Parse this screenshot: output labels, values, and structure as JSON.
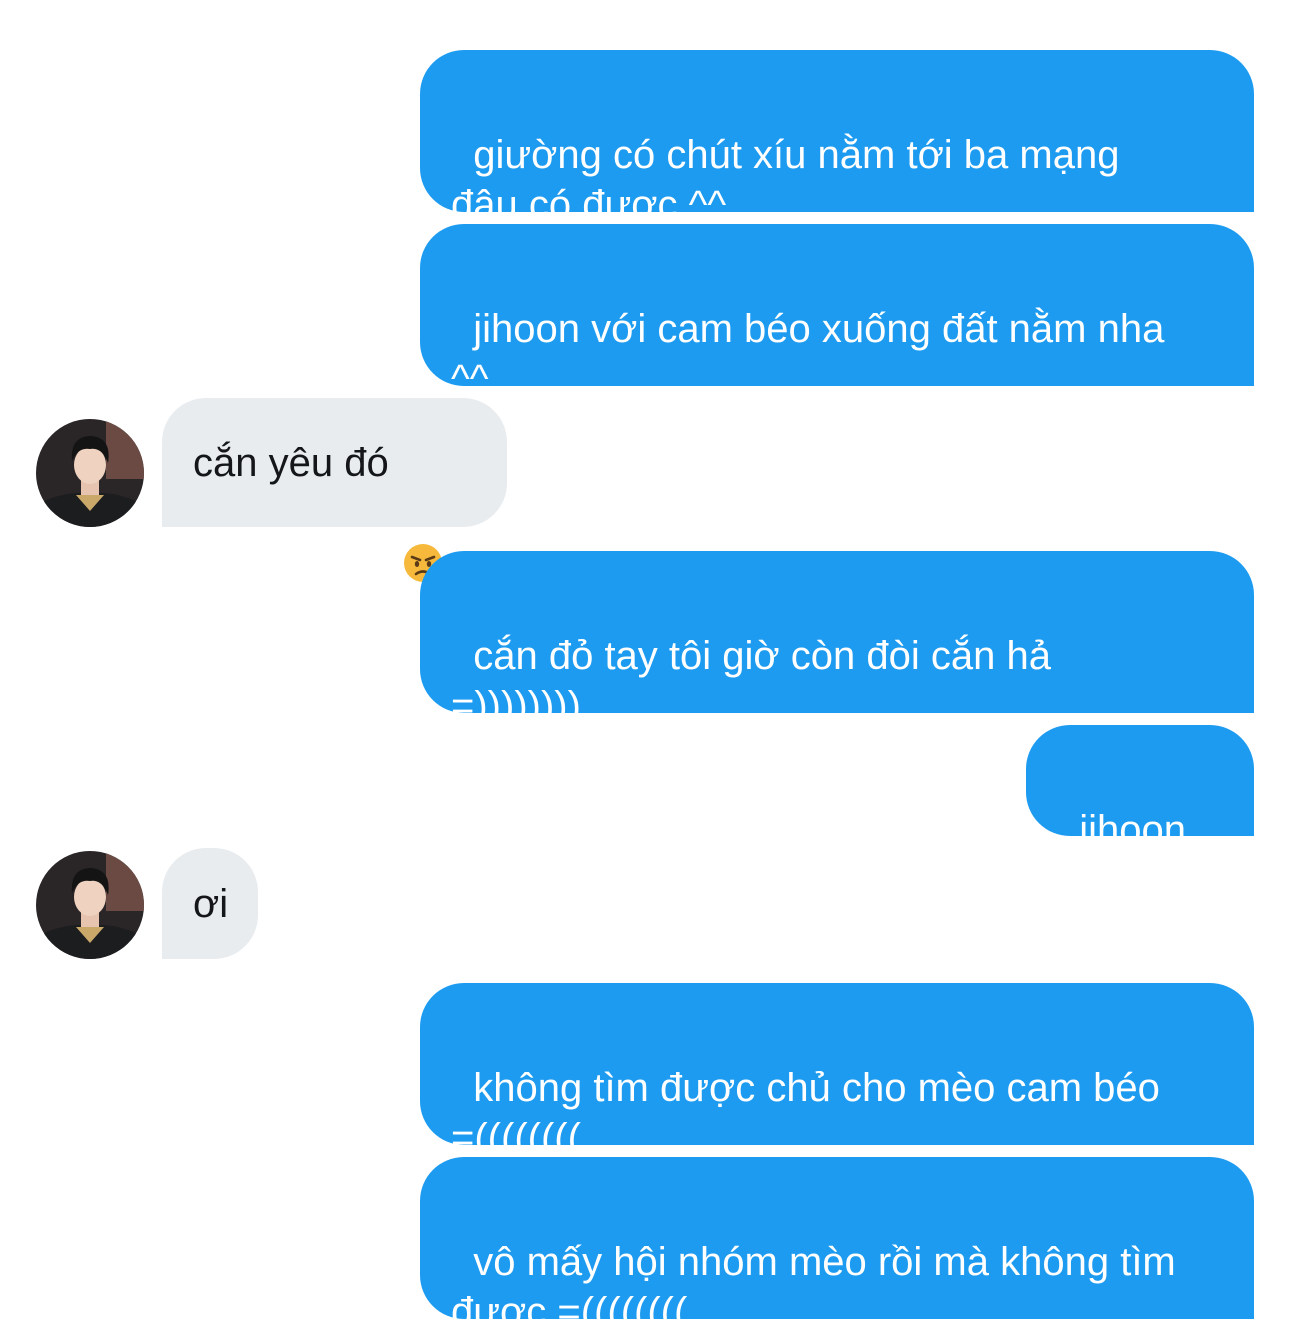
{
  "conversation": {
    "messages": [
      {
        "direction": "sent",
        "text": "giường có chút xíu nằm tới ba mạng\nđâu có được ^^"
      },
      {
        "direction": "sent",
        "text": "jihoon với cam béo xuống đất nằm nha\n^^"
      },
      {
        "direction": "received",
        "text": "cắn yêu đó",
        "emoji": "angry-face-emoji"
      },
      {
        "direction": "sent",
        "text": "cắn đỏ tay tôi giờ còn đòi cắn hả\n=))))))))"
      },
      {
        "direction": "sent",
        "text": "jihoon ơi"
      },
      {
        "direction": "received",
        "text": "ơi"
      },
      {
        "direction": "sent",
        "text": "không tìm được chủ cho mèo cam béo\n=(((((((("
      },
      {
        "direction": "sent",
        "text": "vô mấy hội nhóm mèo rồi mà không tìm\nđược =(((((((("
      }
    ]
  },
  "colors": {
    "sent_bubble": "#1d9bf0",
    "received_bubble": "#e8ecef",
    "sent_text": "#ffffff",
    "received_text": "#141619",
    "background": "#ffffff"
  }
}
